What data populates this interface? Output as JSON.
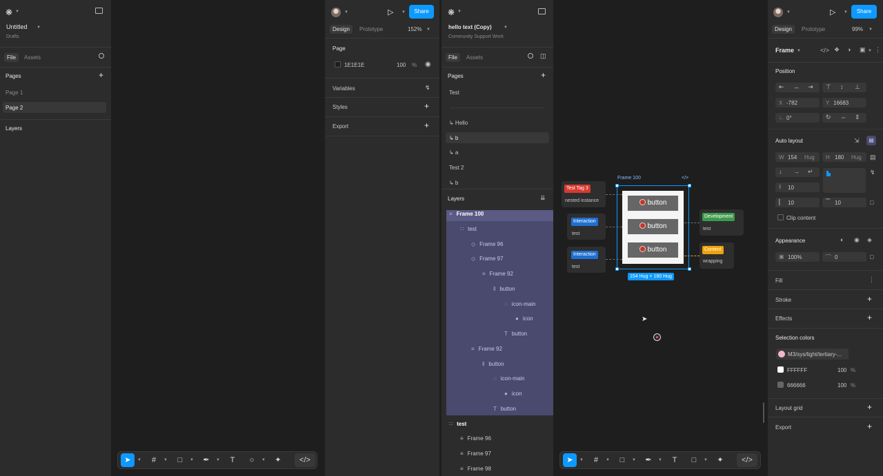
{
  "left_panel": {
    "file_name": "Untitled",
    "location": "Drafts",
    "tab_file": "File",
    "tab_assets": "Assets",
    "pages_title": "Pages",
    "pages": [
      "Page 1",
      "Page 2"
    ],
    "layers_title": "Layers"
  },
  "design_panel_1": {
    "tab_design": "Design",
    "tab_prototype": "Prototype",
    "zoom": "152%",
    "share": "Share",
    "page_title": "Page",
    "page_color": "1E1E1E",
    "page_opacity": "100",
    "percent": "%",
    "variables": "Variables",
    "styles": "Styles",
    "export": "Export"
  },
  "left_panel_2": {
    "file_name": "hello text (Copy)",
    "location": "Community Support Work",
    "tab_file": "File",
    "tab_assets": "Assets",
    "pages_title": "Pages",
    "pages": [
      "Test",
      "↳ Hello",
      "↳ b",
      "↳ a",
      "Test 2",
      "↳ b"
    ],
    "layers_title": "Layers",
    "layers": [
      {
        "name": "Frame 100",
        "icon": "≡",
        "indent": 0
      },
      {
        "name": "test",
        "icon": "∷",
        "indent": 1
      },
      {
        "name": "Frame 96",
        "icon": "◇",
        "indent": 2
      },
      {
        "name": "Frame 97",
        "icon": "◇",
        "indent": 2
      },
      {
        "name": "Frame 92",
        "icon": "≡",
        "indent": 3
      },
      {
        "name": "button",
        "icon": "‖",
        "indent": 4
      },
      {
        "name": "icon-main",
        "icon": "◌",
        "indent": 5
      },
      {
        "name": "icon",
        "icon": "●",
        "indent": 6
      },
      {
        "name": "button",
        "icon": "T",
        "indent": 5
      },
      {
        "name": "Frame 92",
        "icon": "≡",
        "indent": 2
      },
      {
        "name": "button",
        "icon": "‖",
        "indent": 3
      },
      {
        "name": "icon-main",
        "icon": "◌",
        "indent": 4
      },
      {
        "name": "icon",
        "icon": "●",
        "indent": 5
      },
      {
        "name": "button",
        "icon": "T",
        "indent": 4
      },
      {
        "name": "test",
        "icon": "∷",
        "indent": 0
      },
      {
        "name": "Frame 96",
        "icon": "≡",
        "indent": 1
      },
      {
        "name": "Frame 97",
        "icon": "≡",
        "indent": 1
      },
      {
        "name": "Frame 98",
        "icon": "≡",
        "indent": 1
      }
    ]
  },
  "canvas_2": {
    "frame_label": "Frame 100",
    "buttons": [
      "button",
      "button",
      "button"
    ],
    "size_label": "154 Hug × 180 Hug",
    "cards": [
      {
        "tag": "Test Tag 3",
        "tag_color": "#d63b30",
        "text": "nested instance"
      },
      {
        "tag": "Interaction",
        "tag_color": "#1f6fd1",
        "text": "test"
      },
      {
        "tag": "Interaction",
        "tag_color": "#1f6fd1",
        "text": "test"
      },
      {
        "tag": "Development",
        "tag_color": "#3d9a4c",
        "text": "test"
      },
      {
        "tag": "Content",
        "tag_color": "#f0a30a",
        "text": "wrapping"
      }
    ]
  },
  "design_panel_2": {
    "tab_design": "Design",
    "tab_prototype": "Prototype",
    "zoom": "99%",
    "share": "Share",
    "frame_title": "Frame",
    "position": "Position",
    "x_label": "X",
    "x_value": "-782",
    "y_label": "Y",
    "y_value": "16683",
    "rotation": "0°",
    "auto_layout": "Auto layout",
    "w_label": "W",
    "w_value": "154",
    "h_label": "H",
    "h_value": "180",
    "hug": "Hug",
    "gap": "10",
    "pad_h": "10",
    "pad_v": "10",
    "clip_content": "Clip content",
    "appearance": "Appearance",
    "opacity": "100%",
    "radius": "0",
    "fill": "Fill",
    "stroke": "Stroke",
    "effects": "Effects",
    "selection_colors": "Selection colors",
    "colors": [
      {
        "name": "M3/sys/light/tertiary-...",
        "hex": "#f2b8c6",
        "opacity": ""
      },
      {
        "name": "FFFFFF",
        "hex": "#ffffff",
        "opacity": "100"
      },
      {
        "name": "666666",
        "hex": "#666666",
        "opacity": "100"
      }
    ],
    "percent": "%",
    "layout_grid": "Layout grid",
    "export": "Export"
  },
  "help": "?"
}
